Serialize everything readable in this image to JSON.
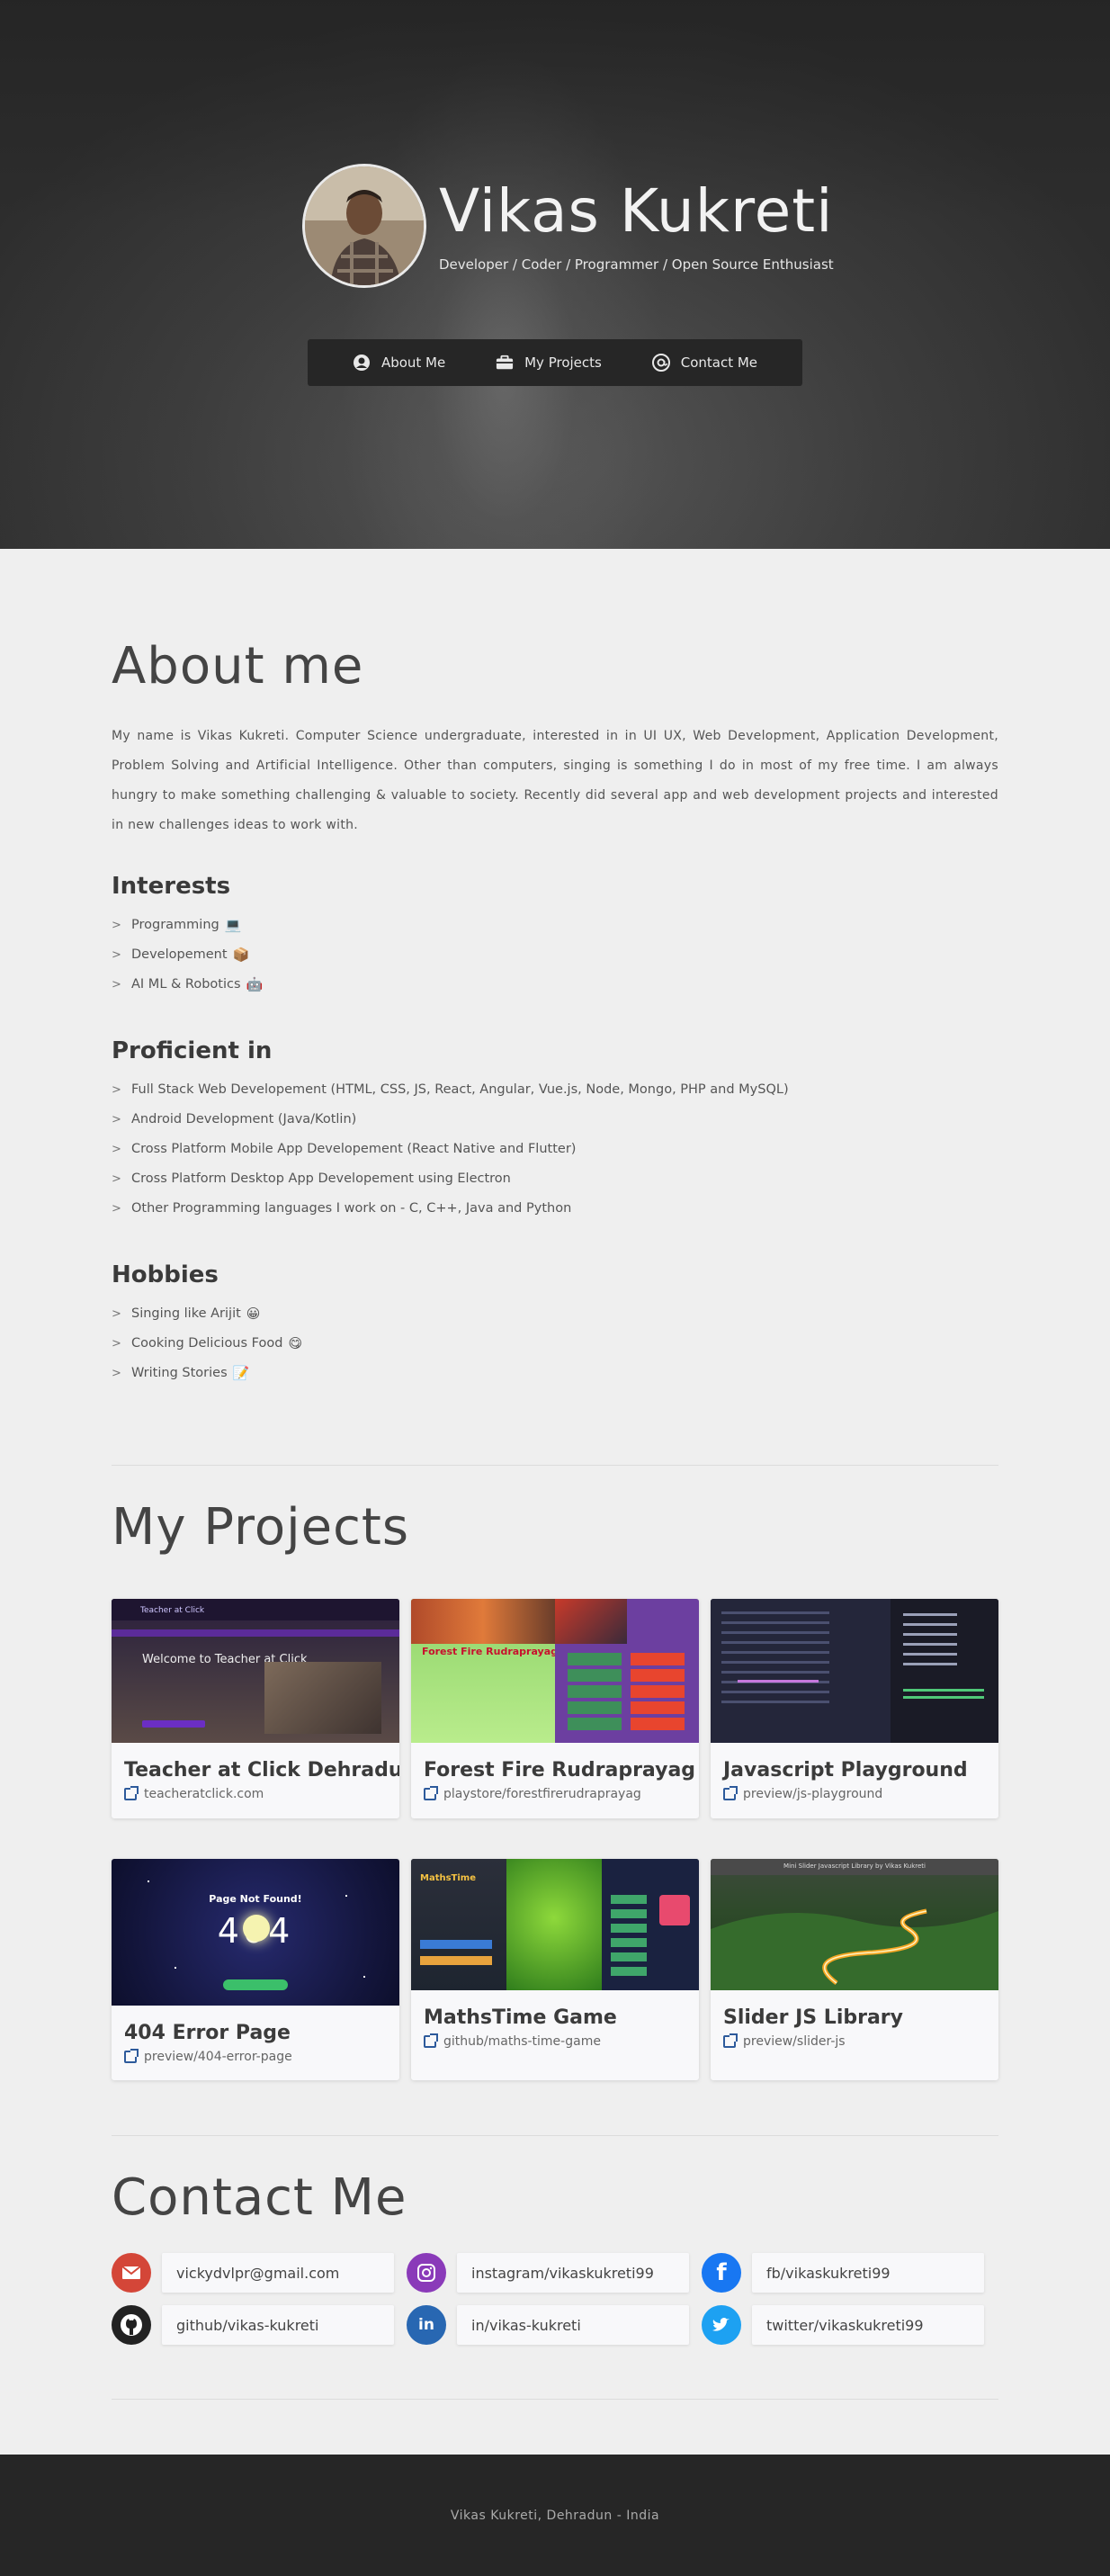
{
  "hero": {
    "name": "Vikas Kukreti",
    "tagline": "Developer / Coder / Programmer / Open Source Enthusiast",
    "nav": [
      {
        "label": "About Me",
        "icon": "user-circle-icon"
      },
      {
        "label": "My Projects",
        "icon": "briefcase-icon"
      },
      {
        "label": "Contact Me",
        "icon": "at-sign-icon"
      }
    ]
  },
  "about": {
    "title": "About me",
    "paragraph": "My name is Vikas Kukreti. Computer Science undergraduate, interested in in UI UX, Web Development, Application Development, Problem Solving and Artificial Intelligence. Other than computers, singing is something I do in most of my free time. I am always hungry to make something challenging & valuable to society. Recently did several app and web development projects and interested in new challenges ideas to work with.",
    "interests": {
      "title": "Interests",
      "items": [
        {
          "text": "Programming",
          "emoji": "💻"
        },
        {
          "text": "Developement",
          "emoji": "📦"
        },
        {
          "text": "AI ML & Robotics",
          "emoji": "🤖"
        }
      ]
    },
    "proficient": {
      "title": "Proficient in",
      "items": [
        "Full Stack Web Developement (HTML, CSS, JS, React, Angular, Vue.js, Node, Mongo, PHP and MySQL)",
        "Android Development (Java/Kotlin)",
        "Cross Platform Mobile App Developement (React Native and Flutter)",
        "Cross Platform Desktop App Developement using Electron",
        "Other Programming languages I work on - C, C++, Java and Python"
      ]
    },
    "hobbies": {
      "title": "Hobbies",
      "items": [
        {
          "text": "Singing like Arijit",
          "emoji": "😀"
        },
        {
          "text": "Cooking Delicious Food",
          "emoji": "😋"
        },
        {
          "text": "Writing Stories",
          "emoji": "📝"
        }
      ]
    }
  },
  "projects": {
    "title": "My Projects",
    "cards": [
      {
        "title": "Teacher at Click Dehradun",
        "link": "teacheratclick.com",
        "thumb_caption": "Welcome to Teacher at Click",
        "thumb_brand": "Teacher at Click"
      },
      {
        "title": "Forest Fire Rudraprayag",
        "link": "playstore/forestfirerudraprayag",
        "thumb_caption": "Forest Fire Rudraprayag"
      },
      {
        "title": "Javascript Playground",
        "link": "preview/js-playground"
      },
      {
        "title": "404 Error Page",
        "link": "preview/404-error-page",
        "thumb_caption": "Page Not Found!",
        "thumb_code": "404"
      },
      {
        "title": "MathsTime Game",
        "link": "github/maths-time-game",
        "thumb_caption": "MathsTime"
      },
      {
        "title": "Slider JS Library",
        "link": "preview/slider-js",
        "thumb_caption": "Mini Slider Javascript Library by Vikas Kukreti"
      }
    ]
  },
  "contact": {
    "title": "Contact Me",
    "items": [
      {
        "text": "vickydvlpr@gmail.com",
        "icon": "email-icon",
        "color": "#d44638"
      },
      {
        "text": "instagram/vikaskukreti99",
        "icon": "instagram-icon",
        "color": "#8a3ab9"
      },
      {
        "text": "fb/vikaskukreti99",
        "icon": "facebook-icon",
        "color": "#1877f2"
      },
      {
        "text": "github/vikas-kukreti",
        "icon": "github-icon",
        "color": "#222222"
      },
      {
        "text": "in/vikas-kukreti",
        "icon": "linkedin-icon",
        "color": "#2867b2"
      },
      {
        "text": "twitter/vikaskukreti99",
        "icon": "twitter-icon",
        "color": "#1da1f2"
      }
    ]
  },
  "footer": {
    "text": "Vikas Kukreti, Dehradun - India"
  }
}
